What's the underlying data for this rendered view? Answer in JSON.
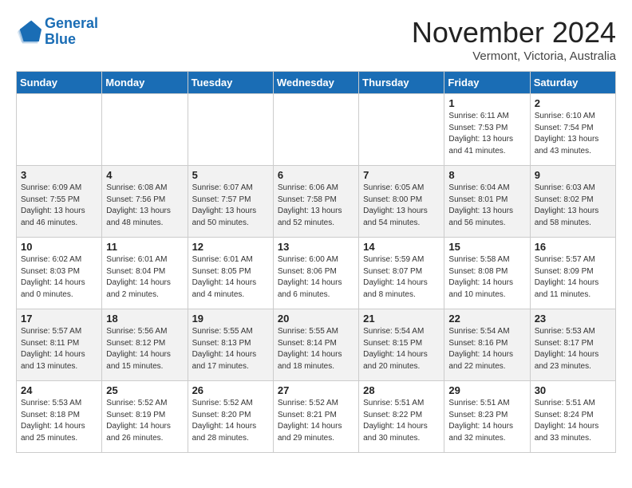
{
  "header": {
    "logo_general": "General",
    "logo_blue": "Blue",
    "month": "November 2024",
    "location": "Vermont, Victoria, Australia"
  },
  "days_of_week": [
    "Sunday",
    "Monday",
    "Tuesday",
    "Wednesday",
    "Thursday",
    "Friday",
    "Saturday"
  ],
  "weeks": [
    [
      {
        "day": "",
        "info": ""
      },
      {
        "day": "",
        "info": ""
      },
      {
        "day": "",
        "info": ""
      },
      {
        "day": "",
        "info": ""
      },
      {
        "day": "",
        "info": ""
      },
      {
        "day": "1",
        "info": "Sunrise: 6:11 AM\nSunset: 7:53 PM\nDaylight: 13 hours\nand 41 minutes."
      },
      {
        "day": "2",
        "info": "Sunrise: 6:10 AM\nSunset: 7:54 PM\nDaylight: 13 hours\nand 43 minutes."
      }
    ],
    [
      {
        "day": "3",
        "info": "Sunrise: 6:09 AM\nSunset: 7:55 PM\nDaylight: 13 hours\nand 46 minutes."
      },
      {
        "day": "4",
        "info": "Sunrise: 6:08 AM\nSunset: 7:56 PM\nDaylight: 13 hours\nand 48 minutes."
      },
      {
        "day": "5",
        "info": "Sunrise: 6:07 AM\nSunset: 7:57 PM\nDaylight: 13 hours\nand 50 minutes."
      },
      {
        "day": "6",
        "info": "Sunrise: 6:06 AM\nSunset: 7:58 PM\nDaylight: 13 hours\nand 52 minutes."
      },
      {
        "day": "7",
        "info": "Sunrise: 6:05 AM\nSunset: 8:00 PM\nDaylight: 13 hours\nand 54 minutes."
      },
      {
        "day": "8",
        "info": "Sunrise: 6:04 AM\nSunset: 8:01 PM\nDaylight: 13 hours\nand 56 minutes."
      },
      {
        "day": "9",
        "info": "Sunrise: 6:03 AM\nSunset: 8:02 PM\nDaylight: 13 hours\nand 58 minutes."
      }
    ],
    [
      {
        "day": "10",
        "info": "Sunrise: 6:02 AM\nSunset: 8:03 PM\nDaylight: 14 hours\nand 0 minutes."
      },
      {
        "day": "11",
        "info": "Sunrise: 6:01 AM\nSunset: 8:04 PM\nDaylight: 14 hours\nand 2 minutes."
      },
      {
        "day": "12",
        "info": "Sunrise: 6:01 AM\nSunset: 8:05 PM\nDaylight: 14 hours\nand 4 minutes."
      },
      {
        "day": "13",
        "info": "Sunrise: 6:00 AM\nSunset: 8:06 PM\nDaylight: 14 hours\nand 6 minutes."
      },
      {
        "day": "14",
        "info": "Sunrise: 5:59 AM\nSunset: 8:07 PM\nDaylight: 14 hours\nand 8 minutes."
      },
      {
        "day": "15",
        "info": "Sunrise: 5:58 AM\nSunset: 8:08 PM\nDaylight: 14 hours\nand 10 minutes."
      },
      {
        "day": "16",
        "info": "Sunrise: 5:57 AM\nSunset: 8:09 PM\nDaylight: 14 hours\nand 11 minutes."
      }
    ],
    [
      {
        "day": "17",
        "info": "Sunrise: 5:57 AM\nSunset: 8:11 PM\nDaylight: 14 hours\nand 13 minutes."
      },
      {
        "day": "18",
        "info": "Sunrise: 5:56 AM\nSunset: 8:12 PM\nDaylight: 14 hours\nand 15 minutes."
      },
      {
        "day": "19",
        "info": "Sunrise: 5:55 AM\nSunset: 8:13 PM\nDaylight: 14 hours\nand 17 minutes."
      },
      {
        "day": "20",
        "info": "Sunrise: 5:55 AM\nSunset: 8:14 PM\nDaylight: 14 hours\nand 18 minutes."
      },
      {
        "day": "21",
        "info": "Sunrise: 5:54 AM\nSunset: 8:15 PM\nDaylight: 14 hours\nand 20 minutes."
      },
      {
        "day": "22",
        "info": "Sunrise: 5:54 AM\nSunset: 8:16 PM\nDaylight: 14 hours\nand 22 minutes."
      },
      {
        "day": "23",
        "info": "Sunrise: 5:53 AM\nSunset: 8:17 PM\nDaylight: 14 hours\nand 23 minutes."
      }
    ],
    [
      {
        "day": "24",
        "info": "Sunrise: 5:53 AM\nSunset: 8:18 PM\nDaylight: 14 hours\nand 25 minutes."
      },
      {
        "day": "25",
        "info": "Sunrise: 5:52 AM\nSunset: 8:19 PM\nDaylight: 14 hours\nand 26 minutes."
      },
      {
        "day": "26",
        "info": "Sunrise: 5:52 AM\nSunset: 8:20 PM\nDaylight: 14 hours\nand 28 minutes."
      },
      {
        "day": "27",
        "info": "Sunrise: 5:52 AM\nSunset: 8:21 PM\nDaylight: 14 hours\nand 29 minutes."
      },
      {
        "day": "28",
        "info": "Sunrise: 5:51 AM\nSunset: 8:22 PM\nDaylight: 14 hours\nand 30 minutes."
      },
      {
        "day": "29",
        "info": "Sunrise: 5:51 AM\nSunset: 8:23 PM\nDaylight: 14 hours\nand 32 minutes."
      },
      {
        "day": "30",
        "info": "Sunrise: 5:51 AM\nSunset: 8:24 PM\nDaylight: 14 hours\nand 33 minutes."
      }
    ]
  ]
}
